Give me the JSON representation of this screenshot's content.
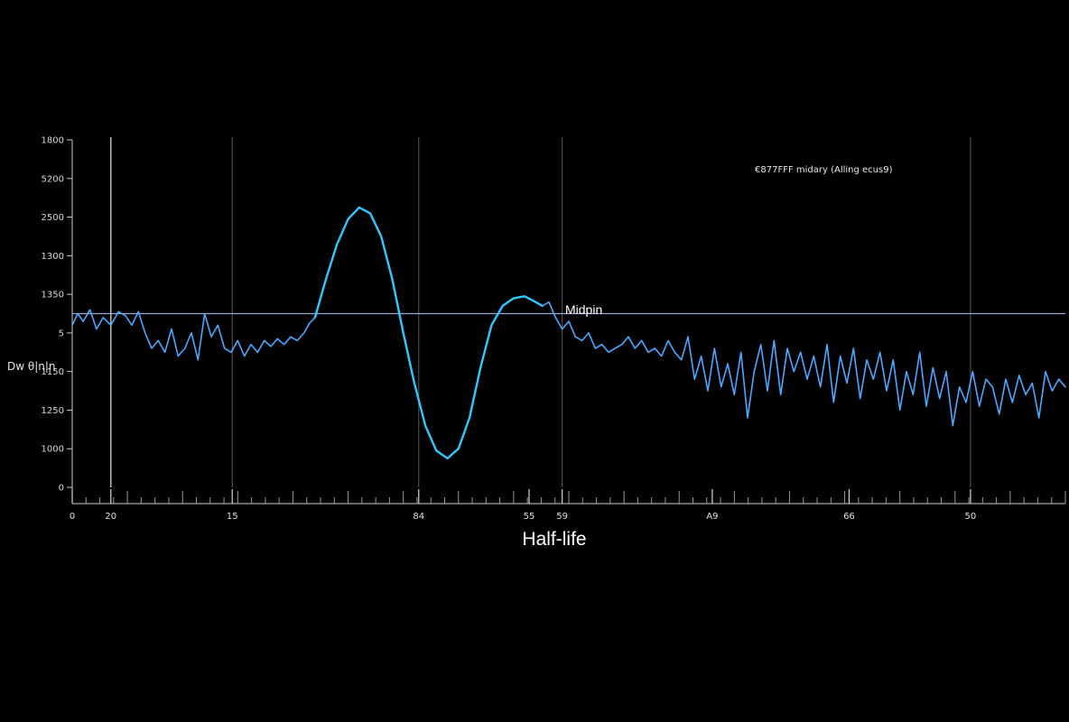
{
  "chart_data": {
    "type": "line",
    "xlabel": "Half-life",
    "ylabel": "Dw θ|n|n",
    "annotation_top_right": "€877FFF midary (Alling  ecus9)",
    "midline_label": "Midpin",
    "y_ticks": [
      "1800",
      "5200",
      "2500",
      "1300",
      "1350",
      "5",
      "1150",
      "1250",
      "1000",
      "0"
    ],
    "x_ticks": [
      "0",
      "20",
      "15",
      "84",
      "55",
      "59",
      "A9",
      "66",
      "50"
    ],
    "x_tick_positions": [
      0,
      3.5,
      14.5,
      31.4,
      41.4,
      44.4,
      58,
      70.4,
      81.4
    ],
    "vertical_gridlines_at": [
      3.5,
      14.5,
      31.4,
      44.4,
      81.4
    ],
    "xlim": [
      0,
      90
    ],
    "ylim": [
      0,
      9
    ],
    "midline_y": 4.5,
    "series": [
      {
        "color": "#4aa8ff",
        "points": [
          [
            0,
            4.2
          ],
          [
            0.5,
            4.5
          ],
          [
            1,
            4.3
          ],
          [
            1.6,
            4.6
          ],
          [
            2.2,
            4.1
          ],
          [
            2.8,
            4.4
          ],
          [
            3.5,
            4.2
          ],
          [
            4.2,
            4.55
          ],
          [
            4.8,
            4.45
          ],
          [
            5.4,
            4.2
          ],
          [
            6,
            4.55
          ],
          [
            6.6,
            4.0
          ],
          [
            7.2,
            3.6
          ],
          [
            7.8,
            3.8
          ],
          [
            8.4,
            3.5
          ],
          [
            9,
            4.1
          ],
          [
            9.6,
            3.4
          ],
          [
            10.2,
            3.6
          ],
          [
            10.8,
            4.0
          ],
          [
            11.4,
            3.3
          ],
          [
            12,
            4.5
          ],
          [
            12.6,
            3.9
          ],
          [
            13.2,
            4.2
          ],
          [
            13.8,
            3.6
          ],
          [
            14.4,
            3.5
          ],
          [
            15,
            3.8
          ],
          [
            15.6,
            3.4
          ],
          [
            16.2,
            3.7
          ],
          [
            16.8,
            3.5
          ],
          [
            17.4,
            3.8
          ],
          [
            18,
            3.65
          ],
          [
            18.6,
            3.85
          ],
          [
            19.2,
            3.7
          ],
          [
            19.8,
            3.9
          ],
          [
            20.4,
            3.8
          ],
          [
            21,
            4.0
          ],
          [
            21.5,
            4.25
          ],
          [
            22,
            4.4
          ]
        ]
      },
      {
        "color": "#2fc8ff",
        "points": [
          [
            22,
            4.4
          ],
          [
            23,
            5.4
          ],
          [
            24,
            6.3
          ],
          [
            25,
            6.95
          ],
          [
            26,
            7.25
          ],
          [
            27,
            7.1
          ],
          [
            28,
            6.5
          ],
          [
            29,
            5.4
          ],
          [
            30,
            4.0
          ],
          [
            31,
            2.7
          ],
          [
            32,
            1.6
          ],
          [
            33,
            0.95
          ],
          [
            34,
            0.75
          ],
          [
            35,
            1.0
          ],
          [
            36,
            1.8
          ],
          [
            37,
            3.1
          ],
          [
            38,
            4.2
          ],
          [
            39,
            4.7
          ],
          [
            40,
            4.9
          ],
          [
            41,
            4.95
          ],
          [
            42,
            4.8
          ],
          [
            42.6,
            4.7
          ]
        ]
      },
      {
        "color": "#4aa8ff",
        "points": [
          [
            42.6,
            4.7
          ],
          [
            43.2,
            4.8
          ],
          [
            43.8,
            4.4
          ],
          [
            44.4,
            4.1
          ],
          [
            45,
            4.3
          ],
          [
            45.6,
            3.9
          ],
          [
            46.2,
            3.8
          ],
          [
            46.8,
            4.0
          ],
          [
            47.4,
            3.6
          ],
          [
            48,
            3.7
          ],
          [
            48.6,
            3.5
          ],
          [
            49.2,
            3.6
          ],
          [
            49.8,
            3.7
          ],
          [
            50.4,
            3.9
          ],
          [
            51,
            3.6
          ],
          [
            51.6,
            3.8
          ],
          [
            52.2,
            3.5
          ],
          [
            52.8,
            3.6
          ],
          [
            53.4,
            3.4
          ],
          [
            54,
            3.8
          ],
          [
            54.6,
            3.5
          ],
          [
            55.2,
            3.3
          ],
          [
            55.8,
            3.9
          ],
          [
            56.4,
            2.8
          ],
          [
            57,
            3.4
          ],
          [
            57.6,
            2.5
          ],
          [
            58.2,
            3.6
          ],
          [
            58.8,
            2.6
          ],
          [
            59.4,
            3.2
          ],
          [
            60,
            2.4
          ],
          [
            60.6,
            3.5
          ],
          [
            61.2,
            1.8
          ],
          [
            61.8,
            3.0
          ],
          [
            62.4,
            3.7
          ],
          [
            63,
            2.5
          ],
          [
            63.6,
            3.8
          ],
          [
            64.2,
            2.4
          ],
          [
            64.8,
            3.6
          ],
          [
            65.4,
            3.0
          ],
          [
            66,
            3.5
          ],
          [
            66.6,
            2.8
          ],
          [
            67.2,
            3.4
          ],
          [
            67.8,
            2.6
          ],
          [
            68.4,
            3.7
          ],
          [
            69,
            2.2
          ],
          [
            69.6,
            3.4
          ],
          [
            70.2,
            2.7
          ],
          [
            70.8,
            3.6
          ],
          [
            71.4,
            2.3
          ],
          [
            72,
            3.3
          ],
          [
            72.6,
            2.8
          ],
          [
            73.2,
            3.5
          ],
          [
            73.8,
            2.5
          ],
          [
            74.4,
            3.3
          ],
          [
            75,
            2.0
          ],
          [
            75.6,
            3.0
          ],
          [
            76.2,
            2.4
          ],
          [
            76.8,
            3.5
          ],
          [
            77.4,
            2.1
          ],
          [
            78,
            3.1
          ],
          [
            78.6,
            2.3
          ],
          [
            79.2,
            3.0
          ],
          [
            79.8,
            1.6
          ],
          [
            80.4,
            2.6
          ],
          [
            81,
            2.2
          ],
          [
            81.6,
            3.0
          ],
          [
            82.2,
            2.1
          ],
          [
            82.8,
            2.8
          ],
          [
            83.4,
            2.6
          ],
          [
            84,
            1.9
          ],
          [
            84.6,
            2.8
          ],
          [
            85.2,
            2.2
          ],
          [
            85.8,
            2.9
          ],
          [
            86.4,
            2.4
          ],
          [
            87,
            2.7
          ],
          [
            87.6,
            1.8
          ],
          [
            88.2,
            3.0
          ],
          [
            88.8,
            2.5
          ],
          [
            89.4,
            2.8
          ],
          [
            90,
            2.6
          ]
        ]
      }
    ]
  }
}
